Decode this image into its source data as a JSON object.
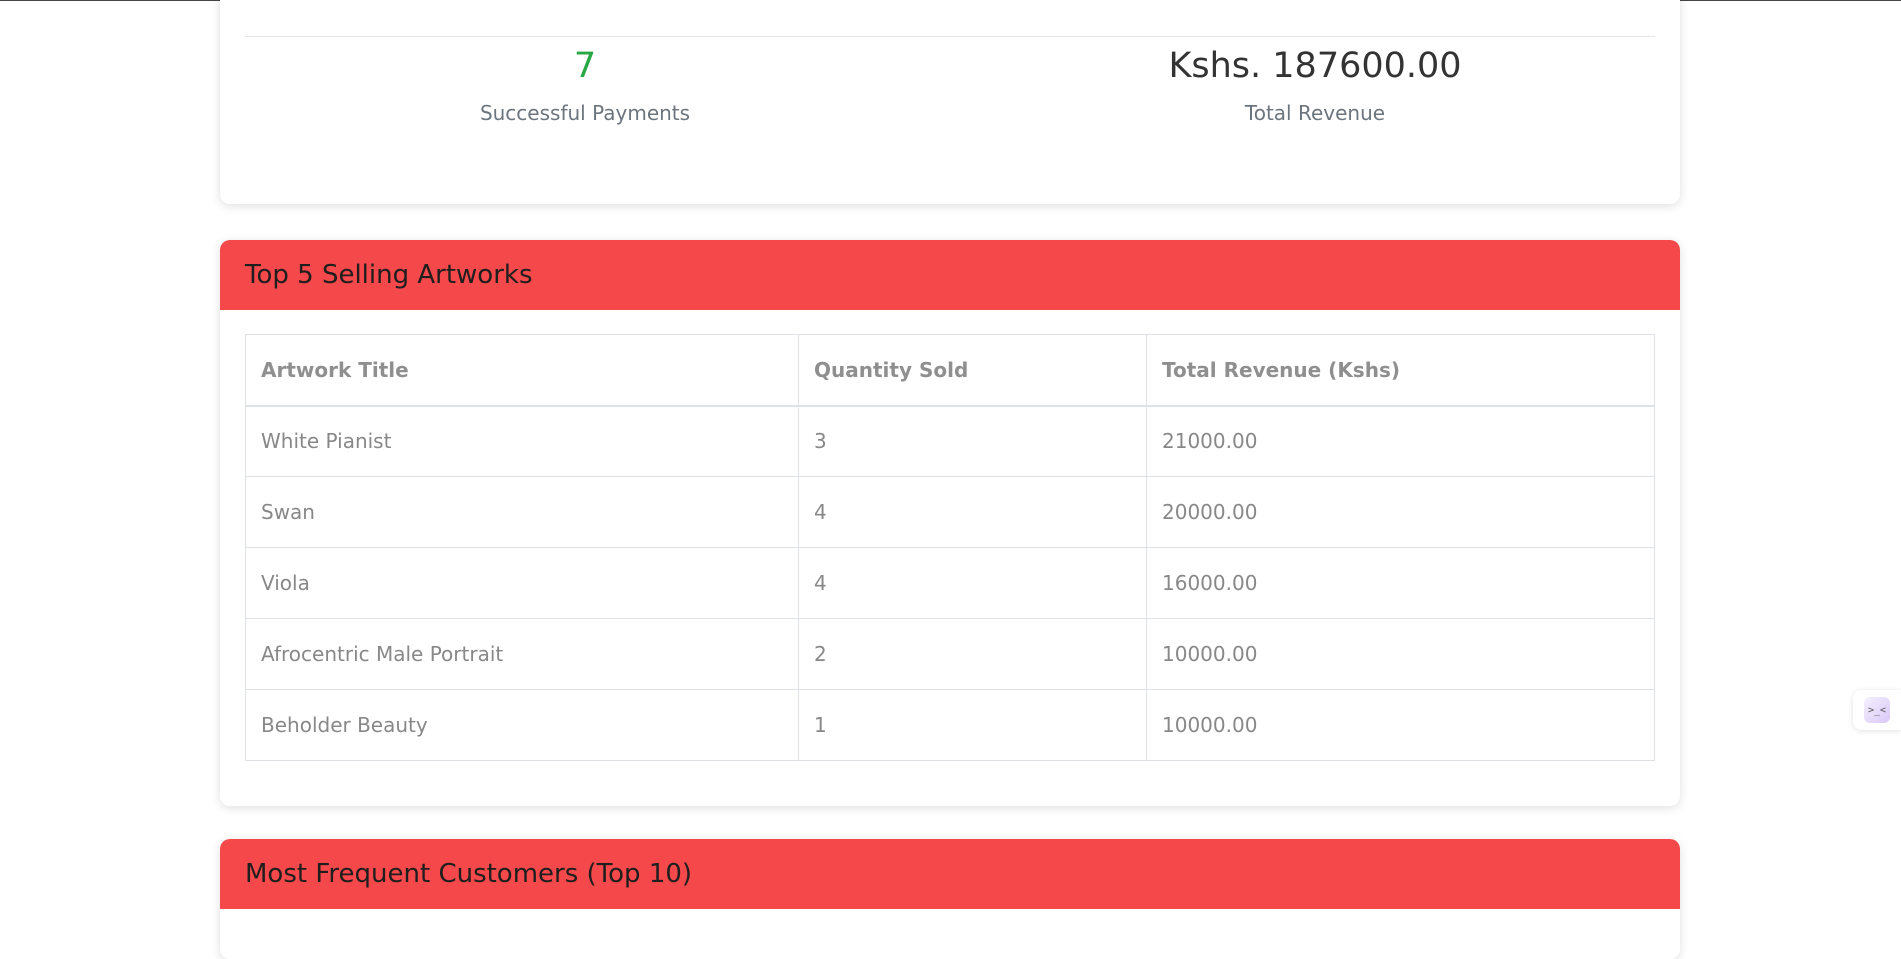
{
  "stats": {
    "successful_payments_value": "7",
    "successful_payments_label": "Successful Payments",
    "total_revenue_value": "Kshs. 187600.00",
    "total_revenue_label": "Total Revenue"
  },
  "top_artworks": {
    "title": "Top 5 Selling Artworks",
    "columns": [
      "Artwork Title",
      "Quantity Sold",
      "Total Revenue (Kshs)"
    ],
    "rows": [
      [
        "White Pianist",
        "3",
        "21000.00"
      ],
      [
        "Swan",
        "4",
        "20000.00"
      ],
      [
        "Viola",
        "4",
        "16000.00"
      ],
      [
        "Afrocentric Male Portrait",
        "2",
        "10000.00"
      ],
      [
        "Beholder Beauty",
        "1",
        "10000.00"
      ]
    ]
  },
  "frequent_customers": {
    "title": "Most Frequent Customers (Top 10)"
  },
  "side_widget": {
    "glyph": ">_<",
    "icon": "assistant-face-icon"
  },
  "colors": {
    "header_accent": "#f4484a",
    "success_green": "#28a745"
  }
}
